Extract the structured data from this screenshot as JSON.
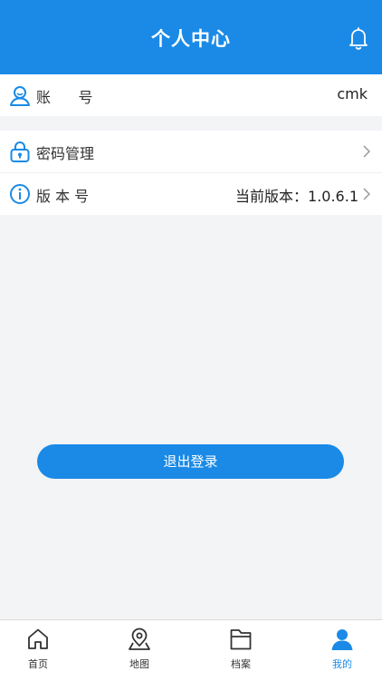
{
  "colors": {
    "primary": "#1a8ae6",
    "background": "#f3f4f6",
    "text": "#333333"
  },
  "header": {
    "title": "个人中心",
    "icon": "bell-icon"
  },
  "account": {
    "icon": "user-icon",
    "label": "账      号",
    "value": "cmk"
  },
  "password": {
    "icon": "lock-icon",
    "label": "密码管理"
  },
  "version": {
    "icon": "info-icon",
    "label": "版 本 号",
    "value": "当前版本：1.0.6.1"
  },
  "logout": {
    "label": "退出登录"
  },
  "tabbar": {
    "items": [
      {
        "label": "首页",
        "icon": "home-icon",
        "active": false
      },
      {
        "label": "地图",
        "icon": "map-pin-icon",
        "active": false
      },
      {
        "label": "档案",
        "icon": "folder-icon",
        "active": false
      },
      {
        "label": "我的",
        "icon": "person-icon",
        "active": true
      }
    ]
  }
}
